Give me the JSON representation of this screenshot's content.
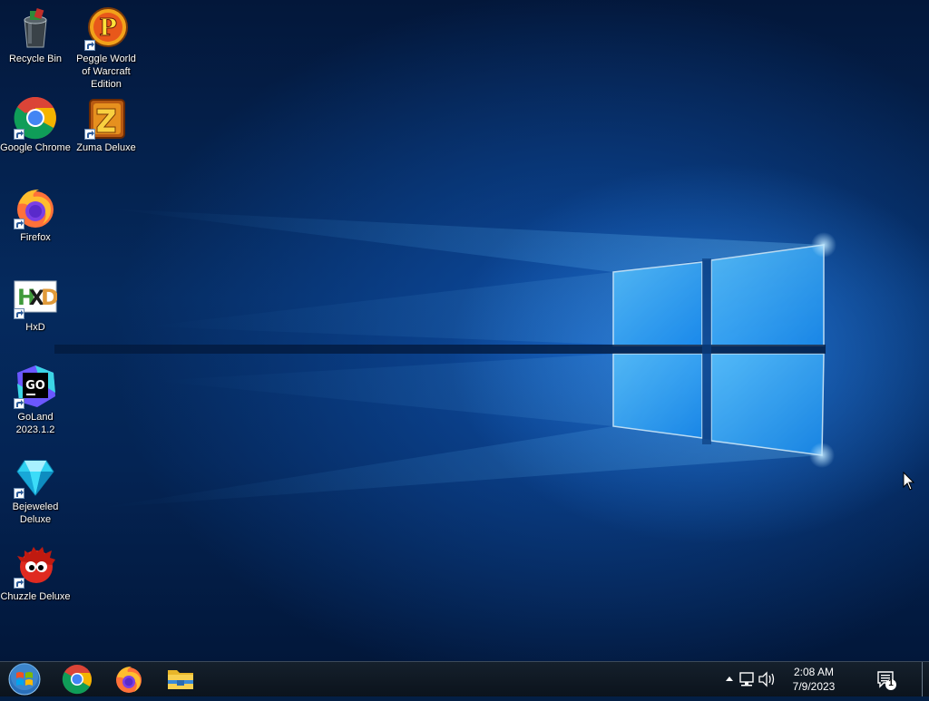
{
  "desktop": {
    "icons": [
      {
        "label": "Recycle Bin",
        "icon": "recycle-bin-icon",
        "shortcut": false
      },
      {
        "label": "Peggle World of Warcraft Edition",
        "icon": "peggle-icon",
        "shortcut": true
      },
      {
        "label": "Google Chrome",
        "icon": "chrome-icon",
        "shortcut": true
      },
      {
        "label": "Zuma Deluxe",
        "icon": "zuma-icon",
        "shortcut": true
      },
      {
        "label": "Firefox",
        "icon": "firefox-icon",
        "shortcut": true
      },
      {
        "label": "HxD",
        "icon": "hxd-icon",
        "shortcut": true
      },
      {
        "label": "GoLand 2023.1.2",
        "icon": "goland-icon",
        "shortcut": true
      },
      {
        "label": "Bejeweled Deluxe",
        "icon": "bejeweled-icon",
        "shortcut": true
      },
      {
        "label": "Chuzzle Deluxe",
        "icon": "chuzzle-icon",
        "shortcut": true
      }
    ]
  },
  "taskbar": {
    "start": {
      "icon": "windows-start-orb-icon"
    },
    "pinned": [
      {
        "name": "Google Chrome",
        "icon": "chrome-icon"
      },
      {
        "name": "Firefox",
        "icon": "firefox-icon"
      },
      {
        "name": "File Explorer",
        "icon": "folder-icon"
      }
    ],
    "tray": {
      "show_hidden_icon": "chevron-up-icon",
      "network_icon": "network-icon",
      "volume_icon": "speaker-icon",
      "time": "2:08 AM",
      "date": "7/9/2023",
      "notification_icon": "action-center-icon",
      "notification_count": "1"
    }
  },
  "colors": {
    "accent": "#1e90ff",
    "taskbar": "#101a24",
    "wallpaper_dark": "#03173a"
  }
}
